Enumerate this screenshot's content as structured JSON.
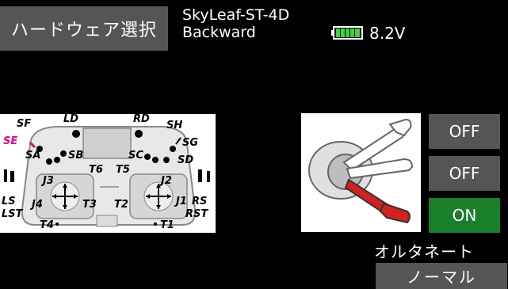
{
  "header": {
    "hardware_select_label": "ハードウェア選択",
    "model_name": "SkyLeaf-ST-4D",
    "model_direction": "Backward",
    "battery_voltage": "8.2V",
    "battery_level": 1.0
  },
  "transmitter_labels": {
    "SF": "SF",
    "SE": "SE",
    "SA": "SA",
    "SB": "SB",
    "LD": "LD",
    "RD": "RD",
    "SH": "SH",
    "SG": "SG",
    "SC": "SC",
    "SD": "SD",
    "T6": "T6",
    "T5": "T5",
    "J3": "J3",
    "J4": "J4",
    "J2": "J2",
    "J1": "J1",
    "T3": "T3",
    "T2": "T2",
    "LS": "LS",
    "LST": "LST",
    "RS": "RS",
    "RST": "RST",
    "T4": "T4",
    "T1": "T1"
  },
  "switch_positions": [
    {
      "label": "OFF",
      "state": "off"
    },
    {
      "label": "OFF",
      "state": "off"
    },
    {
      "label": "ON",
      "state": "on"
    }
  ],
  "mode": {
    "label": "オルタネート",
    "value": "ノーマル"
  },
  "colors": {
    "button_gray": "#555555",
    "on_green": "#1a7f2b",
    "highlight_pink": "#e6007e",
    "lever_red": "#d42020",
    "battery_green": "#3fd13f"
  }
}
